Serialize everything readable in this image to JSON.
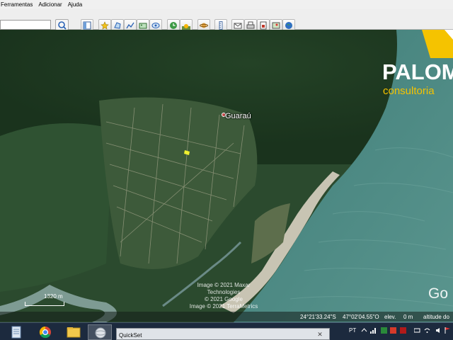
{
  "menu": {
    "items": [
      {
        "label": "Ferramentas"
      },
      {
        "label": "Adicionar"
      },
      {
        "label": "Ajuda"
      }
    ]
  },
  "map": {
    "place_label": "Guaraú",
    "attribution_lines": [
      "Image © 2021 Maxar Technologies",
      "© 2021 Google",
      "Image © 2021 TerraMetrics"
    ],
    "google_mark": "Go",
    "scale_label": "1320 m",
    "status": {
      "lat": "24°21'33.24\"S",
      "lon": "47°02'04.55\"O",
      "elev_label": "elev.",
      "elev_value": "0 m",
      "altitude_label": "altitude do"
    }
  },
  "brand": {
    "name": "PALOM",
    "subtitle": "consultoria"
  },
  "taskbar": {
    "preview_title": "QuickSet",
    "preview_close": "✕",
    "language": "PT"
  },
  "colors": {
    "forest": "#27492c",
    "ocean": "#4f8a83",
    "beach": "#c9c5b6",
    "brand_yellow": "#f5c300"
  }
}
